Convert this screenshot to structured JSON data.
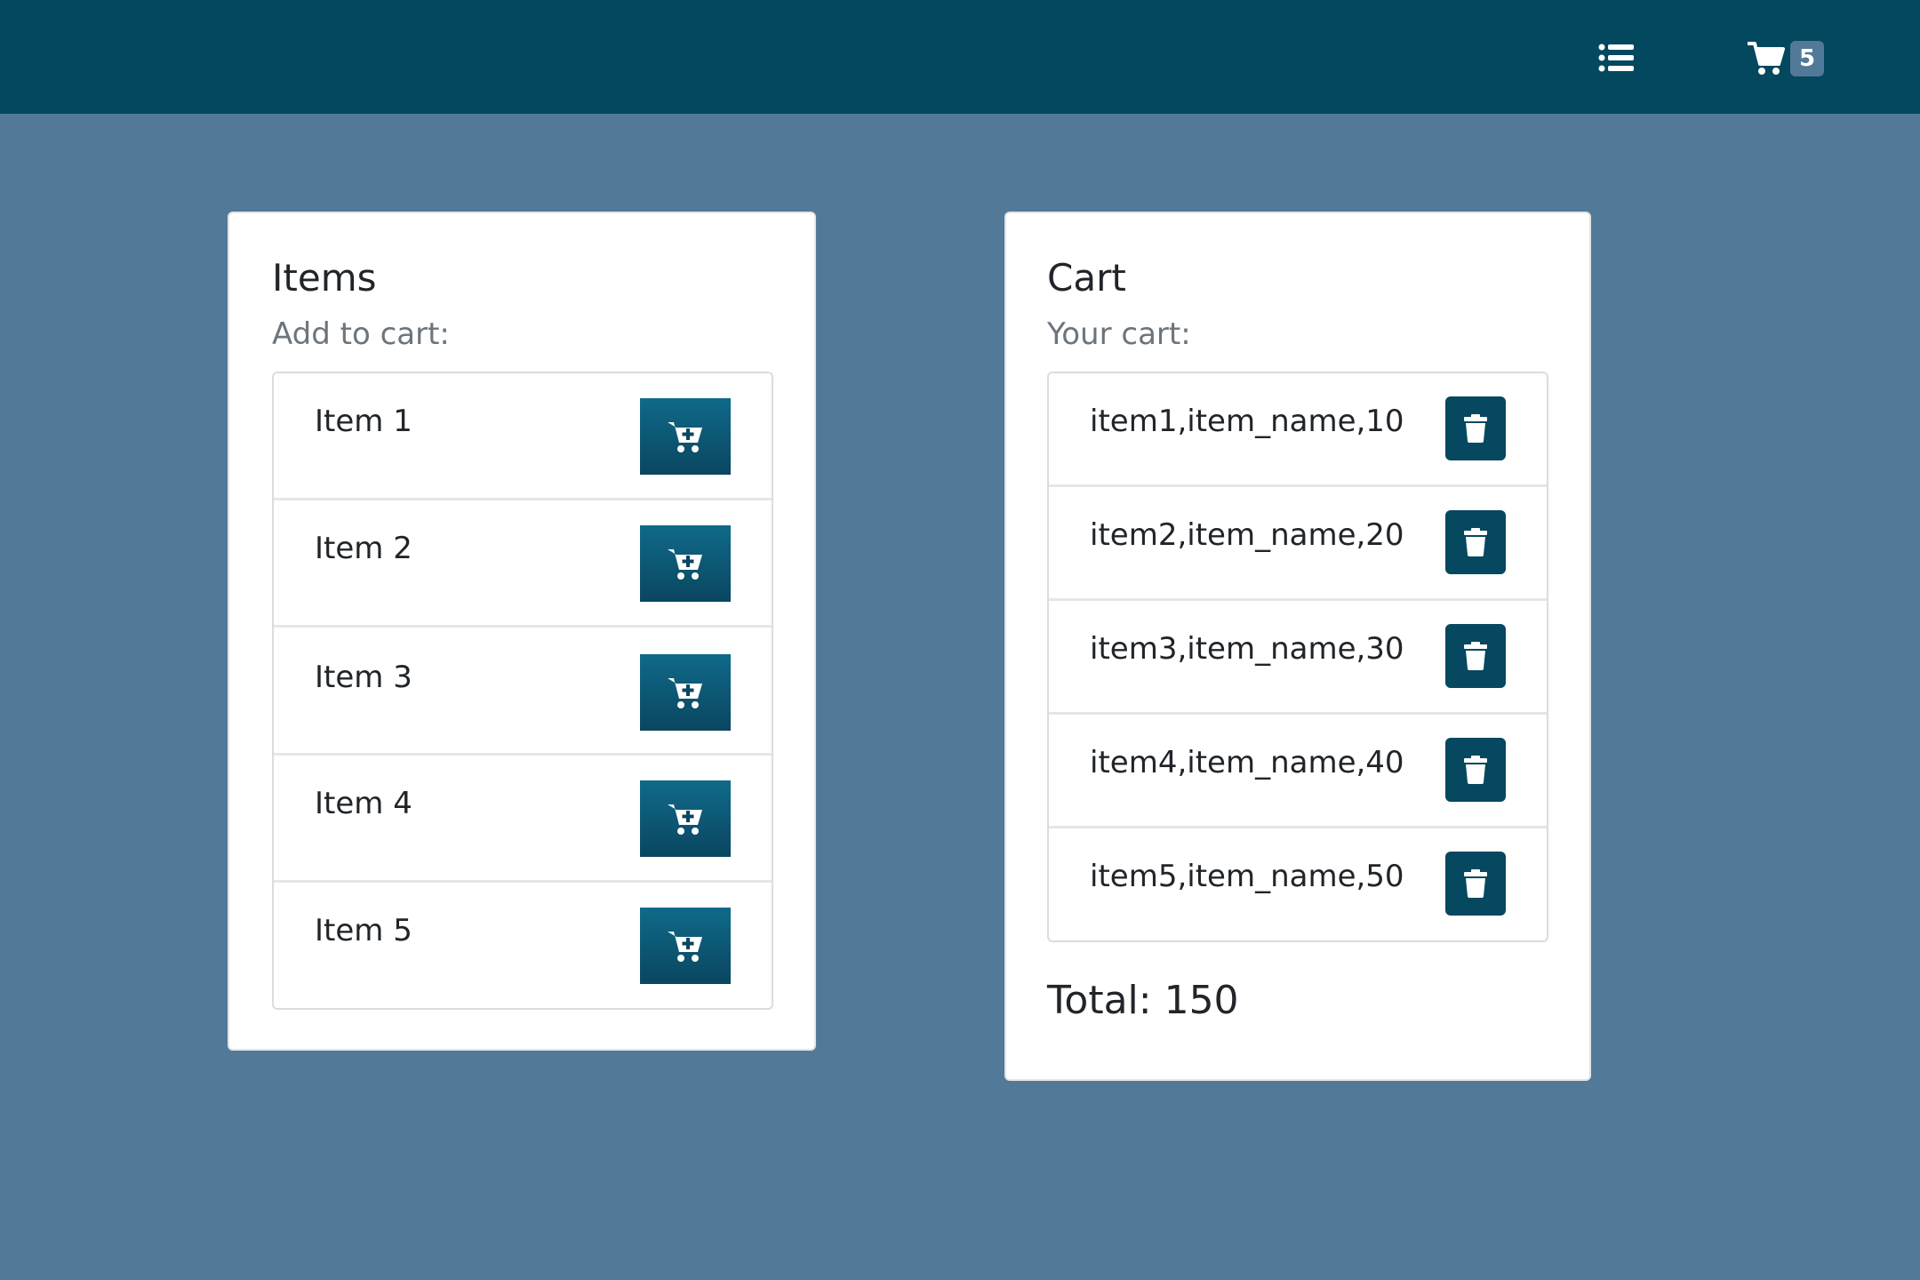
{
  "navbar": {
    "list_icon": "list-icon",
    "cart_icon": "cart-icon",
    "cart_count": "5"
  },
  "items_card": {
    "title": "Items",
    "subtitle": "Add to cart:",
    "items": [
      {
        "label": "Item 1",
        "icon": "cart-plus-icon"
      },
      {
        "label": "Item 2",
        "icon": "cart-plus-icon"
      },
      {
        "label": "Item 3",
        "icon": "cart-plus-icon"
      },
      {
        "label": "Item 4",
        "icon": "cart-plus-icon"
      },
      {
        "label": "Item 5",
        "icon": "cart-plus-icon"
      }
    ]
  },
  "cart_card": {
    "title": "Cart",
    "subtitle": "Your cart:",
    "items": [
      {
        "label": "item1,item_name,10",
        "icon": "trash-icon"
      },
      {
        "label": "item2,item_name,20",
        "icon": "trash-icon"
      },
      {
        "label": "item3,item_name,30",
        "icon": "trash-icon"
      },
      {
        "label": "item4,item_name,40",
        "icon": "trash-icon"
      },
      {
        "label": "item5,item_name,50",
        "icon": "trash-icon"
      }
    ],
    "total": "Total: 150"
  },
  "colors": {
    "navbar": "#04485f",
    "background": "#527a98",
    "button": "#0a4660"
  }
}
